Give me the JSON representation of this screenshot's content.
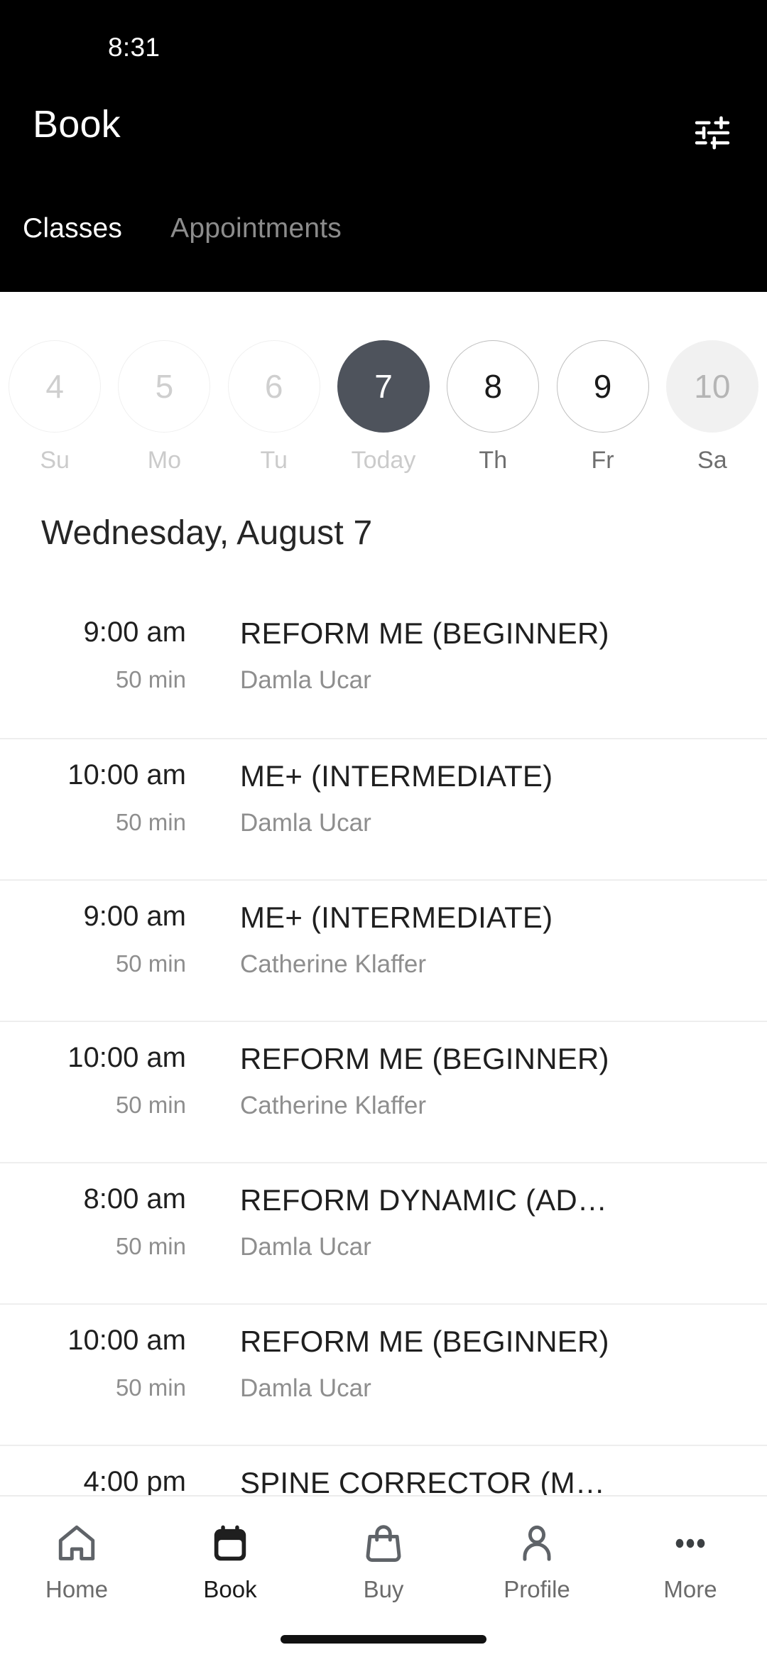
{
  "status_bar": {
    "time": "8:31"
  },
  "header": {
    "title": "Book",
    "filter_icon": "tune-icon",
    "tabs": [
      {
        "label": "Classes",
        "active": true
      },
      {
        "label": "Appointments",
        "active": false
      }
    ]
  },
  "date_strip": {
    "days": [
      {
        "number": "4",
        "label": "Su",
        "state": "past"
      },
      {
        "number": "5",
        "label": "Mo",
        "state": "past"
      },
      {
        "number": "6",
        "label": "Tu",
        "state": "past"
      },
      {
        "number": "7",
        "label": "Today",
        "state": "today"
      },
      {
        "number": "8",
        "label": "Th",
        "state": "future"
      },
      {
        "number": "9",
        "label": "Fr",
        "state": "future"
      },
      {
        "number": "10",
        "label": "Sa",
        "state": "filled"
      }
    ]
  },
  "day_heading": "Wednesday, August 7",
  "classes": [
    {
      "time": "9:00 am",
      "duration": "50 min",
      "name": "REFORM ME (BEGINNER)",
      "instructor": "Damla Ucar"
    },
    {
      "time": "10:00 am",
      "duration": "50 min",
      "name": "ME+ (INTERMEDIATE)",
      "instructor": "Damla Ucar"
    },
    {
      "time": "9:00 am",
      "duration": "50 min",
      "name": "ME+ (INTERMEDIATE)",
      "instructor": "Catherine Klaffer"
    },
    {
      "time": "10:00 am",
      "duration": "50 min",
      "name": "REFORM ME (BEGINNER)",
      "instructor": "Catherine Klaffer"
    },
    {
      "time": "8:00 am",
      "duration": "50 min",
      "name": "REFORM DYNAMIC (AD…",
      "instructor": "Damla Ucar"
    },
    {
      "time": "10:00 am",
      "duration": "50 min",
      "name": "REFORM ME (BEGINNER)",
      "instructor": "Damla Ucar"
    },
    {
      "time": "4:00 pm",
      "duration": "",
      "name": "SPINE CORRECTOR (M…",
      "instructor": ""
    }
  ],
  "bottom_nav": [
    {
      "label": "Home",
      "icon": "home-icon",
      "active": false
    },
    {
      "label": "Book",
      "icon": "calendar-icon",
      "active": true
    },
    {
      "label": "Buy",
      "icon": "bag-icon",
      "active": false
    },
    {
      "label": "Profile",
      "icon": "person-icon",
      "active": false
    },
    {
      "label": "More",
      "icon": "ellipsis-icon",
      "active": false
    }
  ],
  "colors": {
    "header_background": "#000000",
    "selected_day": "#4e535c",
    "muted_text": "#8e8e8e",
    "primary_text": "#1f1f1f",
    "divider": "#eeeeee"
  }
}
